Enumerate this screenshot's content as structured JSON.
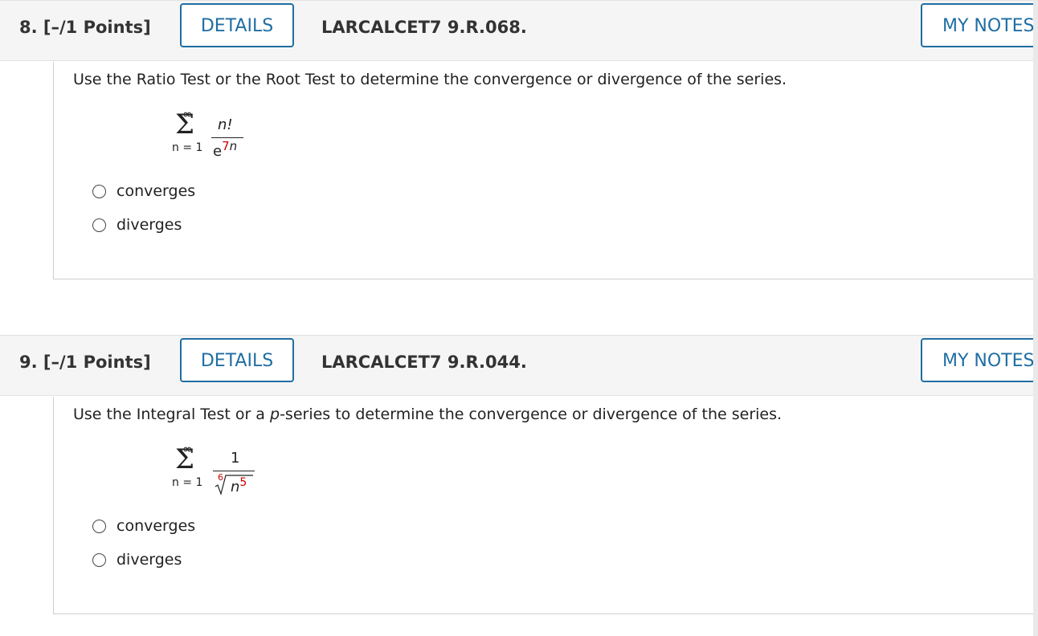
{
  "questions": [
    {
      "number_label": "8.",
      "points": "[–/1 Points]",
      "details_label": "DETAILS",
      "code": "LARCALCET7 9.R.068.",
      "notes_label": "MY NOTES",
      "prompt": "Use the Ratio Test or the Root Test to determine the convergence or divergence of the series.",
      "series": {
        "upper": "∞",
        "sigma": "Σ",
        "lower": "n = 1",
        "numerator": "n!",
        "denominator_base": "e",
        "denominator_exp_coef": "7",
        "denominator_exp_var": "n"
      },
      "options": [
        "converges",
        "diverges"
      ]
    },
    {
      "number_label": "9.",
      "points": "[–/1 Points]",
      "details_label": "DETAILS",
      "code": "LARCALCET7 9.R.044.",
      "notes_label": "MY NOTES",
      "prompt_pre": "Use the Integral Test or a ",
      "prompt_p": "p",
      "prompt_post": "-series to determine the convergence or divergence of the series.",
      "series": {
        "upper": "∞",
        "sigma": "Σ",
        "lower": "n = 1",
        "numerator": "1",
        "root_index": "6",
        "radicand": "n",
        "radicand_exp": "5"
      },
      "options": [
        "converges",
        "diverges"
      ]
    }
  ],
  "colors": {
    "accent": "#1f6ea3",
    "highlight": "#cc0000",
    "header_bg": "#f5f5f5"
  }
}
